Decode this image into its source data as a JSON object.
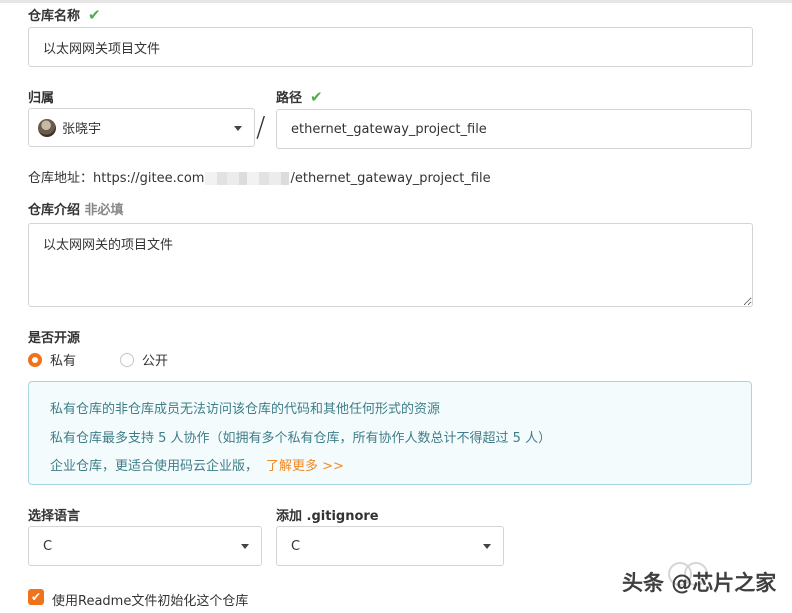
{
  "repo_name": {
    "label": "仓库名称",
    "check": "✔",
    "value": "以太网网关项目文件"
  },
  "owner": {
    "label": "归属",
    "value": "张晓宇"
  },
  "path": {
    "label": "路径",
    "check": "✔",
    "separator": "/",
    "value": "ethernet_gateway_project_file"
  },
  "address": {
    "label": "仓库地址：",
    "prefix": "https://gitee.com",
    "suffix": "/ethernet_gateway_project_file"
  },
  "intro": {
    "label": "仓库介绍",
    "optional": "非必填",
    "value": "以太网网关的项目文件"
  },
  "visibility": {
    "label": "是否开源",
    "options": [
      {
        "label": "私有",
        "selected": true
      },
      {
        "label": "公开",
        "selected": false
      }
    ]
  },
  "notice": {
    "lines": [
      "私有仓库的非仓库成员无法访问该仓库的代码和其他任何形式的资源",
      "私有仓库最多支持 5 人协作（如拥有多个私有仓库，所有协作人数总计不得超过 5 人）",
      "企业仓库，更适合使用码云企业版，"
    ],
    "link": "了解更多 >>"
  },
  "language": {
    "label": "选择语言",
    "value": "C"
  },
  "gitignore": {
    "label": "添加 .gitignore",
    "value": "C"
  },
  "readme": {
    "label": "使用Readme文件初始化这个仓库",
    "checked": true,
    "check_glyph": "✔"
  },
  "watermark": "头条 @芯片之家",
  "colors": {
    "accent": "#f0721b",
    "success": "#4cae4c",
    "notice_text": "#3e7e88",
    "notice_border": "#a9d5de",
    "link": "#f08a24"
  }
}
